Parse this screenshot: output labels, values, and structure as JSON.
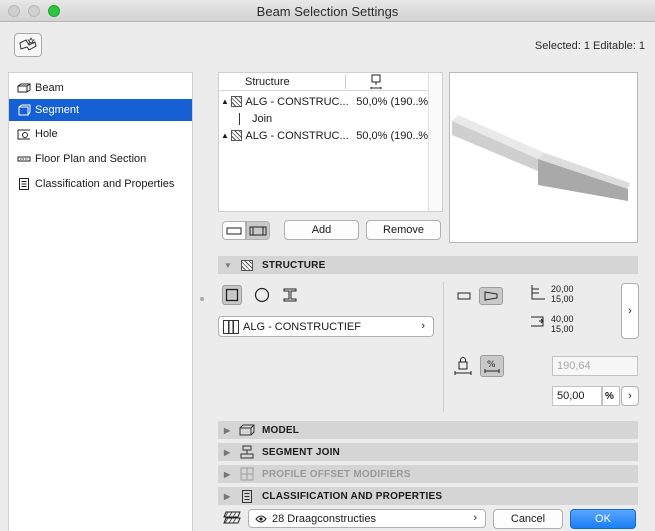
{
  "window": {
    "title": "Beam Selection Settings"
  },
  "header": {
    "selected_info": "Selected: 1 Editable: 1"
  },
  "sidebar": {
    "items": [
      {
        "label": "Beam",
        "icon": "beam-icon",
        "active": false
      },
      {
        "label": "Segment",
        "icon": "segment-icon",
        "active": true
      },
      {
        "label": "Hole",
        "icon": "hole-icon",
        "active": false
      },
      {
        "label": "Floor Plan and Section",
        "icon": "floor-plan-icon",
        "active": false
      },
      {
        "label": "Classification and Properties",
        "icon": "classification-icon",
        "active": false
      }
    ]
  },
  "structure_table": {
    "column_header": "Structure",
    "rows": [
      {
        "name": "ALG - CONSTRUC...",
        "value": "50,0% (190...",
        "suffix": "%"
      },
      {
        "join_label": "Join"
      },
      {
        "name": "ALG - CONSTRUC...",
        "value": "50,0% (190...",
        "suffix": "%"
      }
    ]
  },
  "table_buttons": {
    "add": "Add",
    "remove": "Remove"
  },
  "sections": {
    "structure": "STRUCTURE",
    "model": "MODEL",
    "segment_join": "SEGMENT JOIN",
    "profile_offset": "PROFILE OFFSET MODIFIERS",
    "classification": "CLASSIFICATION AND PROPERTIES"
  },
  "structure_panel": {
    "building_material": "ALG - CONSTRUCTIEF",
    "dim_top_1": "20,00",
    "dim_top_2": "15,00",
    "dim_bottom_1": "40,00",
    "dim_bottom_2": "15,00",
    "height_value": "190,64",
    "percent_value": "50,00",
    "percent_unit": "%"
  },
  "footer": {
    "layer": "28 Draagconstructies",
    "cancel": "Cancel",
    "ok": "OK"
  },
  "colors": {
    "accent": "#1560d4",
    "ok_button": "#1a7ef5",
    "section_bg": "#d5d5d5"
  }
}
